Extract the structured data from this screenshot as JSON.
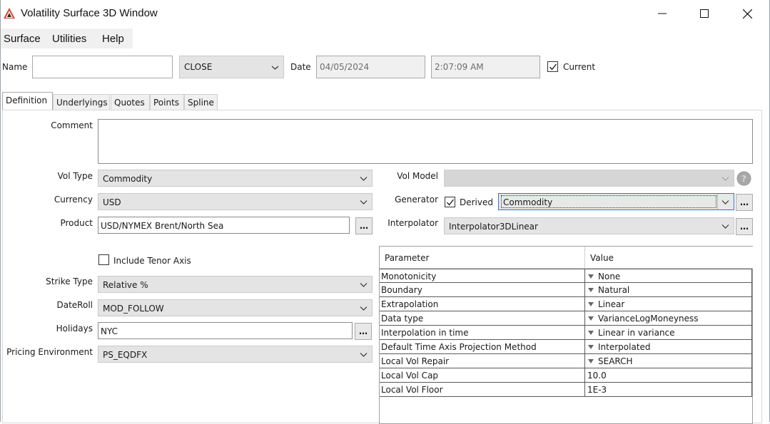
{
  "window": {
    "title": "Volatility Surface 3D Window"
  },
  "menu": {
    "items": [
      "Surface",
      "Utilities",
      "Help"
    ]
  },
  "top": {
    "name_label": "Name",
    "name_value": "",
    "close_combo": "CLOSE",
    "date_label": "Date",
    "date_value": "04/05/2024",
    "time_value": "2:07:09 AM",
    "current_label": "Current",
    "current_checked": true
  },
  "tabs": [
    "Definition",
    "Underlyings",
    "Quotes",
    "Points",
    "Spline"
  ],
  "definition": {
    "comment_label": "Comment",
    "comment_value": "",
    "vol_type_label": "Vol Type",
    "vol_type_value": "Commodity",
    "currency_label": "Currency",
    "currency_value": "USD",
    "product_label": "Product",
    "product_value": "USD/NYMEX Brent/North Sea",
    "include_tenor_label": "Include Tenor Axis",
    "strike_type_label": "Strike Type",
    "strike_type_value": "Relative %",
    "dateroll_label": "DateRoll",
    "dateroll_value": "MOD_FOLLOW",
    "holidays_label": "Holidays",
    "holidays_value": "NYC",
    "pricing_env_label": "Pricing Environment",
    "pricing_env_value": "PS_EQDFX",
    "vol_model_label": "Vol Model",
    "vol_model_value": "",
    "generator_label": "Generator",
    "derived_label": "Derived",
    "generator_value": "Commodity",
    "interpolator_label": "Interpolator",
    "interpolator_value": "Interpolator3DLinear"
  },
  "params": {
    "header_parameter": "Parameter",
    "header_value": "Value",
    "rows": [
      {
        "name": "Monotonicity",
        "value": "None",
        "dropdown": true
      },
      {
        "name": "Boundary",
        "value": "Natural",
        "dropdown": true
      },
      {
        "name": "Extrapolation",
        "value": "Linear",
        "dropdown": true
      },
      {
        "name": "Data type",
        "value": "VarianceLogMoneyness",
        "dropdown": true
      },
      {
        "name": "Interpolation in time",
        "value": "Linear in variance",
        "dropdown": true
      },
      {
        "name": "Default Time Axis Projection Method",
        "value": "Interpolated",
        "dropdown": true
      },
      {
        "name": "Local Vol Repair",
        "value": "SEARCH",
        "dropdown": true
      },
      {
        "name": "Local Vol Cap",
        "value": "10.0",
        "dropdown": false
      },
      {
        "name": "Local Vol Floor",
        "value": "1E-3",
        "dropdown": false
      }
    ]
  },
  "colors": {
    "accent_red": "#c0392b",
    "combo_bg": "#e4e4e4",
    "disabled_bg": "#f0f0f0"
  },
  "icons": [
    "app-logo-icon",
    "minimize-icon",
    "maximize-icon",
    "close-icon",
    "chevron-down-icon",
    "checkmark-icon",
    "help-icon",
    "ellipsis-icon"
  ]
}
